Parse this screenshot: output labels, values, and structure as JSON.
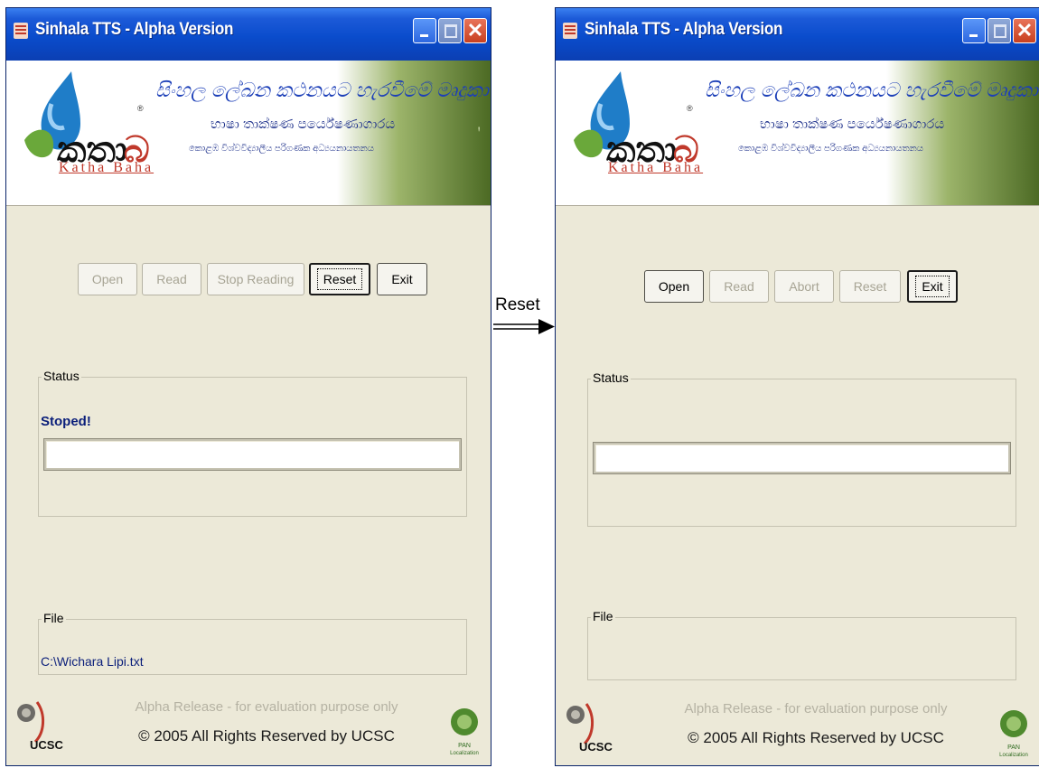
{
  "transition": {
    "label": "Reset"
  },
  "windows": [
    {
      "title": "Sinhala TTS - Alpha Version",
      "banner": {
        "line1": "සිංහල ලේඛන කථනයට හැරවීමේ මෘදුකාංගය",
        "line2": "භාෂා තාක්ෂණ පර්යේෂණාගාරය",
        "line3": "කොළඹ විශ්වවිද්‍යාලීය පරිගණක අධ්‍යයනායතනය",
        "logo_text": "Katha Baha"
      },
      "buttons": [
        {
          "label": "Open",
          "state": "disabled"
        },
        {
          "label": "Read",
          "state": "disabled"
        },
        {
          "label": "Stop Reading",
          "state": "disabled"
        },
        {
          "label": "Reset",
          "state": "focused"
        },
        {
          "label": "Exit",
          "state": "enabled"
        }
      ],
      "status": {
        "group_label": "Status",
        "message": "Stoped!"
      },
      "file": {
        "group_label": "File",
        "path": "C:\\Wichara Lipi.txt"
      },
      "footer": {
        "note": "Alpha Release - for evaluation purpose only",
        "copyright": "© 2005 All Rights Reserved by UCSC",
        "ucsc_label": "UCSC"
      }
    },
    {
      "title": "Sinhala TTS - Alpha Version",
      "banner": {
        "line1": "සිංහල ලේඛන කථනයට හැරවීමේ මෘදුකාංගය",
        "line2": "භාෂා තාක්ෂණ පර්යේෂණාගාරය",
        "line3": "කොළඹ විශ්වවිද්‍යාලීය පරිගණක අධ්‍යයනායතනය",
        "logo_text": "Katha Baha"
      },
      "buttons": [
        {
          "label": "Open",
          "state": "enabled"
        },
        {
          "label": "Read",
          "state": "disabled"
        },
        {
          "label": "Abort",
          "state": "disabled"
        },
        {
          "label": "Reset",
          "state": "disabled"
        },
        {
          "label": "Exit",
          "state": "focused"
        }
      ],
      "status": {
        "group_label": "Status",
        "message": ""
      },
      "file": {
        "group_label": "File",
        "path": ""
      },
      "footer": {
        "note": "Alpha Release - for evaluation purpose only",
        "copyright": "© 2005 All Rights Reserved by UCSC",
        "ucsc_label": "UCSC"
      }
    }
  ],
  "colors": {
    "titlebar": "#0a4ccc",
    "status_text": "#0a1e7a",
    "window_bg": "#ece9d8"
  },
  "icons": [
    "app-icon",
    "minimize-icon",
    "maximize-icon",
    "close-icon",
    "katha-baha-logo-icon",
    "ucsc-crest-icon",
    "pan-localization-icon",
    "double-arrow-icon"
  ]
}
